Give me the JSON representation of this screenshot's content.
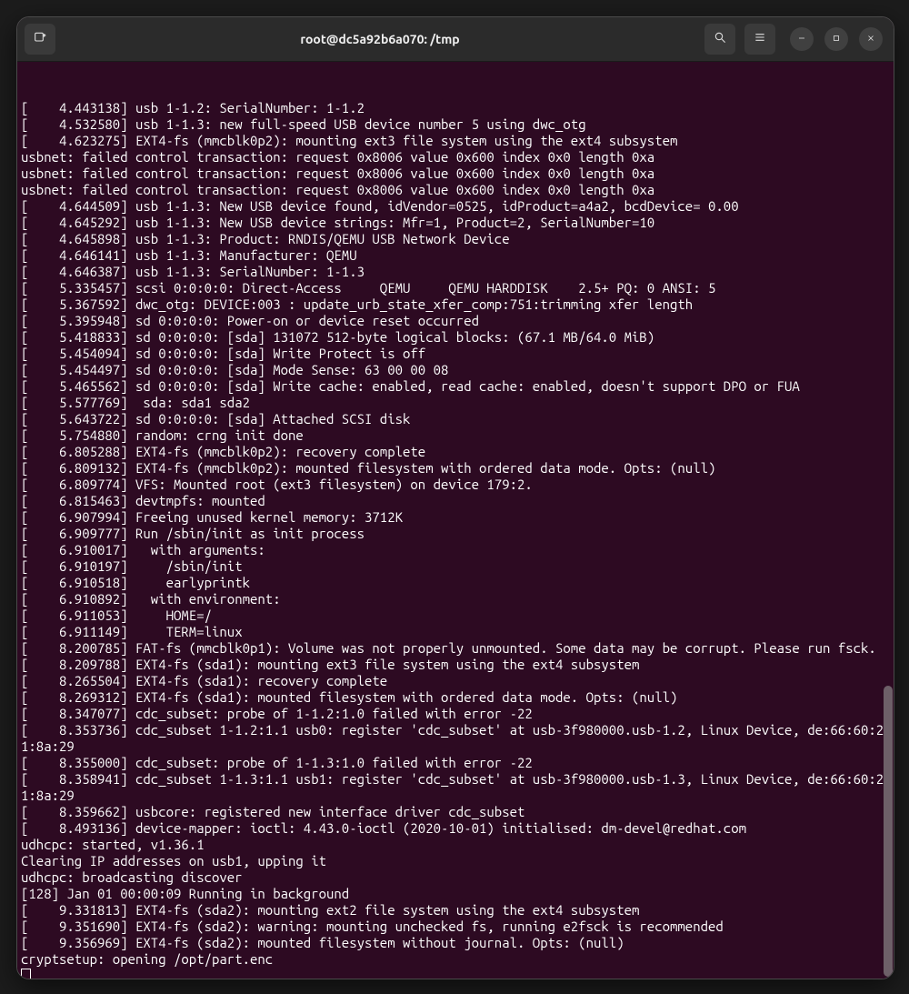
{
  "titlebar": {
    "title": "root@dc5a92b6a070: /tmp"
  },
  "terminal": {
    "lines": [
      "[    4.443138] usb 1-1.2: SerialNumber: 1-1.2",
      "[    4.532580] usb 1-1.3: new full-speed USB device number 5 using dwc_otg",
      "[    4.623275] EXT4-fs (mmcblk0p2): mounting ext3 file system using the ext4 subsystem",
      "usbnet: failed control transaction: request 0x8006 value 0x600 index 0x0 length 0xa",
      "usbnet: failed control transaction: request 0x8006 value 0x600 index 0x0 length 0xa",
      "usbnet: failed control transaction: request 0x8006 value 0x600 index 0x0 length 0xa",
      "[    4.644509] usb 1-1.3: New USB device found, idVendor=0525, idProduct=a4a2, bcdDevice= 0.00",
      "[    4.645292] usb 1-1.3: New USB device strings: Mfr=1, Product=2, SerialNumber=10",
      "[    4.645898] usb 1-1.3: Product: RNDIS/QEMU USB Network Device",
      "[    4.646141] usb 1-1.3: Manufacturer: QEMU",
      "[    4.646387] usb 1-1.3: SerialNumber: 1-1.3",
      "[    5.335457] scsi 0:0:0:0: Direct-Access     QEMU     QEMU HARDDISK    2.5+ PQ: 0 ANSI: 5",
      "[    5.367592] dwc_otg: DEVICE:003 : update_urb_state_xfer_comp:751:trimming xfer length",
      "[    5.395948] sd 0:0:0:0: Power-on or device reset occurred",
      "[    5.418833] sd 0:0:0:0: [sda] 131072 512-byte logical blocks: (67.1 MB/64.0 MiB)",
      "[    5.454094] sd 0:0:0:0: [sda] Write Protect is off",
      "[    5.454497] sd 0:0:0:0: [sda] Mode Sense: 63 00 00 08",
      "[    5.465562] sd 0:0:0:0: [sda] Write cache: enabled, read cache: enabled, doesn't support DPO or FUA",
      "[    5.577769]  sda: sda1 sda2",
      "[    5.643722] sd 0:0:0:0: [sda] Attached SCSI disk",
      "[    5.754880] random: crng init done",
      "[    6.805288] EXT4-fs (mmcblk0p2): recovery complete",
      "[    6.809132] EXT4-fs (mmcblk0p2): mounted filesystem with ordered data mode. Opts: (null)",
      "[    6.809774] VFS: Mounted root (ext3 filesystem) on device 179:2.",
      "[    6.815463] devtmpfs: mounted",
      "[    6.907994] Freeing unused kernel memory: 3712K",
      "[    6.909777] Run /sbin/init as init process",
      "[    6.910017]   with arguments:",
      "[    6.910197]     /sbin/init",
      "[    6.910518]     earlyprintk",
      "[    6.910892]   with environment:",
      "[    6.911053]     HOME=/",
      "[    6.911149]     TERM=linux",
      "[    8.200785] FAT-fs (mmcblk0p1): Volume was not properly unmounted. Some data may be corrupt. Please run fsck.",
      "[    8.209788] EXT4-fs (sda1): mounting ext3 file system using the ext4 subsystem",
      "[    8.265504] EXT4-fs (sda1): recovery complete",
      "[    8.269312] EXT4-fs (sda1): mounted filesystem with ordered data mode. Opts: (null)",
      "[    8.347077] cdc_subset: probe of 1-1.2:1.0 failed with error -22",
      "[    8.353736] cdc_subset 1-1.2:1.1 usb0: register 'cdc_subset' at usb-3f980000.usb-1.2, Linux Device, de:66:60:21:8a:29",
      "[    8.355000] cdc_subset: probe of 1-1.3:1.0 failed with error -22",
      "[    8.358941] cdc_subset 1-1.3:1.1 usb1: register 'cdc_subset' at usb-3f980000.usb-1.3, Linux Device, de:66:60:21:8a:29",
      "[    8.359662] usbcore: registered new interface driver cdc_subset",
      "[    8.493136] device-mapper: ioctl: 4.43.0-ioctl (2020-10-01) initialised: dm-devel@redhat.com",
      "udhcpc: started, v1.36.1",
      "Clearing IP addresses on usb1, upping it",
      "udhcpc: broadcasting discover",
      "[128] Jan 01 00:00:09 Running in background",
      "[    9.331813] EXT4-fs (sda2): mounting ext2 file system using the ext4 subsystem",
      "[    9.351690] EXT4-fs (sda2): warning: mounting unchecked fs, running e2fsck is recommended",
      "[    9.356969] EXT4-fs (sda2): mounted filesystem without journal. Opts: (null)",
      "cryptsetup: opening /opt/part.enc"
    ]
  }
}
